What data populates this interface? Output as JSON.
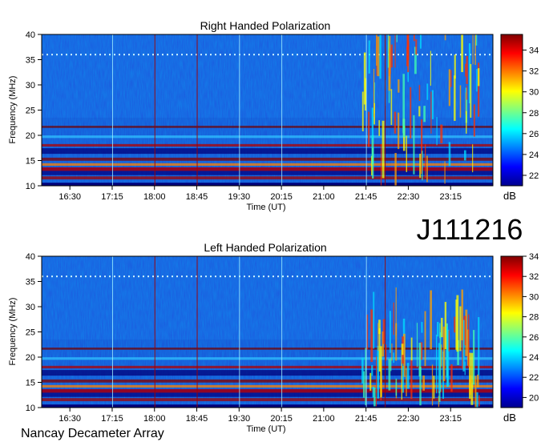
{
  "header": {
    "id_label": "J111216"
  },
  "footer": {
    "observatory": "Nancay Decameter Array"
  },
  "chart_data": [
    {
      "type": "heatmap",
      "title": "Right Handed Polarization",
      "xlabel": "Time (UT)",
      "ylabel": "Frequency (MHz)",
      "xticks": [
        "16:30",
        "17:15",
        "18:00",
        "18:45",
        "19:30",
        "20:15",
        "21:00",
        "21:45",
        "22:30",
        "23:15"
      ],
      "yticks": [
        10,
        15,
        20,
        25,
        30,
        35,
        40
      ],
      "ylim": [
        10,
        40
      ],
      "xlim": [
        "16:00",
        "00:00"
      ],
      "colorbar": {
        "label": "dB",
        "ticks": [
          22,
          24,
          26,
          28,
          30,
          32,
          34
        ],
        "range": [
          21,
          35.5
        ]
      },
      "colormap": "jet"
    },
    {
      "type": "heatmap",
      "title": "Left Handed Polarization",
      "xlabel": "Time (UT)",
      "ylabel": "Frequency (MHz)",
      "xticks": [
        "16:30",
        "17:15",
        "18:00",
        "18:45",
        "19:30",
        "20:15",
        "21:00",
        "21:45",
        "22:30",
        "23:15"
      ],
      "yticks": [
        10,
        15,
        20,
        25,
        30,
        35,
        40
      ],
      "ylim": [
        10,
        40
      ],
      "xlim": [
        "16:00",
        "00:00"
      ],
      "colorbar": {
        "label": "dB",
        "ticks": [
          20,
          22,
          24,
          26,
          28,
          30,
          32,
          34
        ],
        "range": [
          19,
          34
        ]
      },
      "colormap": "jet"
    }
  ]
}
